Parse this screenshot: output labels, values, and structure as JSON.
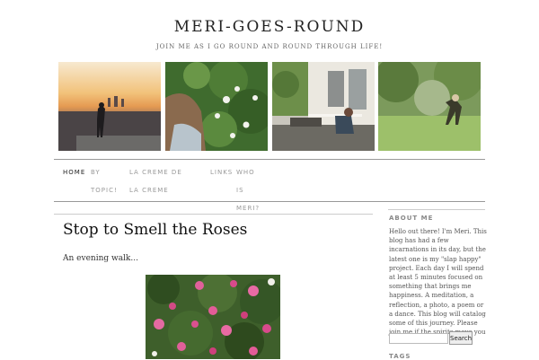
{
  "site": {
    "title": "MERI-GOES-ROUND",
    "description": "JOIN ME AS I GO ROUND AND ROUND THROUGH LIFE!"
  },
  "banner": {
    "photos": [
      {
        "icon": "sunset-city-photo"
      },
      {
        "icon": "girl-with-flowers-photo"
      },
      {
        "icon": "porch-photo"
      },
      {
        "icon": "garden-photo"
      }
    ]
  },
  "nav": {
    "home": "HOME",
    "by_topic": "BY TOPIC!",
    "creme": "LA CREME DE LA CREME",
    "links": "LINKS",
    "who_is": "WHO IS MERI?"
  },
  "post": {
    "title": "Stop to Smell the Roses",
    "excerpt": "An evening walk..."
  },
  "sidebar": {
    "about_heading": "ABOUT ME",
    "about_text": "Hello out there! I'm Meri. This blog has had a few incarnations in its day, but the latest one is my \"slap happy\" project. Each day I will spend at least 5 minutes focused on something that brings me happiness. A meditation, a reflection, a photo, a poem or a dance. This blog will catalog some of this journey. Please join me if the spirits move you :)",
    "search_placeholder": "",
    "search_button": "Search",
    "tags_heading": "TAGS"
  }
}
